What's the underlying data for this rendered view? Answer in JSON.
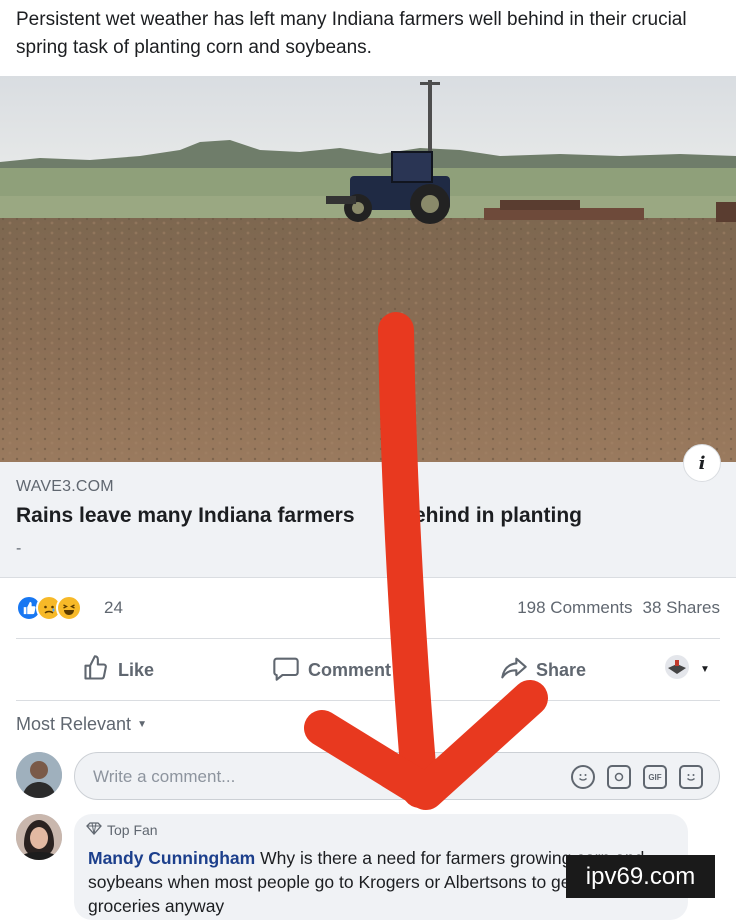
{
  "post": {
    "text": "Persistent wet weather has left many Indiana farmers well behind in their crucial spring task of planting corn and soybeans."
  },
  "link": {
    "domain": "WAVE3.COM",
    "title": "Rains leave many Indiana farmers     ll behind in planting",
    "description": "-"
  },
  "reactions": {
    "icons": [
      "like-reaction",
      "sad-reaction",
      "haha-reaction"
    ],
    "count": "24",
    "comments": "198 Comments",
    "shares": "38 Shares"
  },
  "actions": {
    "like": "Like",
    "comment": "Comment",
    "share": "Share"
  },
  "comments_section": {
    "sort_label": "Most Relevant",
    "composer_placeholder": "Write a comment...",
    "composer_icons": [
      "emoji-icon",
      "camera-icon",
      "gif-icon",
      "sticker-icon"
    ],
    "gif_label": "GIF"
  },
  "comment": {
    "badge": "Top Fan",
    "author": "Mandy Cunningham",
    "text": "Why is there a need for farmers growing corn and soybeans when most people go to Krogers or Albertsons to get groceries anyway"
  },
  "watermark": "ipv69.com",
  "colors": {
    "arrow": "#e8391f",
    "fb_blue": "#1877f2",
    "author_blue": "#1c3f8c"
  }
}
